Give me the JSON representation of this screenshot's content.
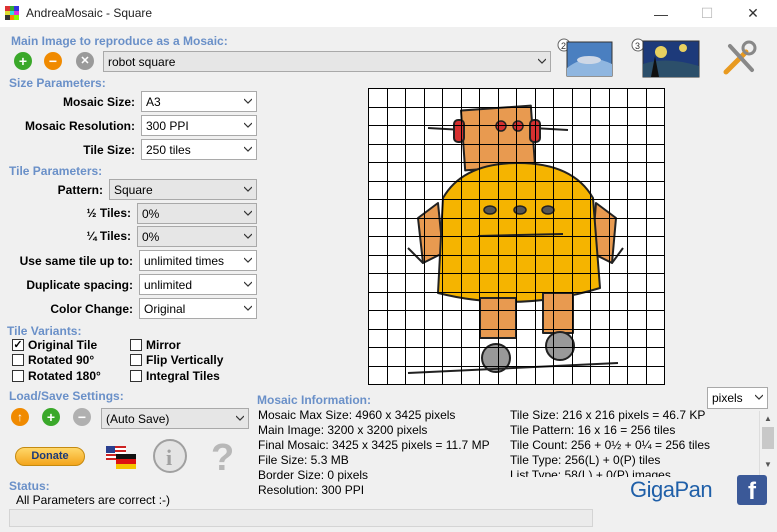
{
  "window": {
    "title": "AndreaMosaic - Square",
    "minimize": "—",
    "maximize": "☐",
    "close": "✕"
  },
  "main_image": {
    "section_label": "Main Image to reproduce as a Mosaic:",
    "selected": "robot square"
  },
  "size_params": {
    "section_label": "Size Parameters:",
    "mosaic_size_label": "Mosaic Size:",
    "mosaic_size_value": "A3",
    "resolution_label": "Mosaic Resolution:",
    "resolution_value": "300 PPI",
    "tile_size_label": "Tile Size:",
    "tile_size_value": "250 tiles"
  },
  "tile_params": {
    "section_label": "Tile Parameters:",
    "pattern_label": "Pattern:",
    "pattern_value": "Square",
    "half_tiles_label": "½ Tiles:",
    "half_tiles_value": "0%",
    "quarter_tiles_label": "¼ Tiles:",
    "quarter_tiles_value": "0%",
    "same_tile_label": "Use same tile up to:",
    "same_tile_value": "unlimited times",
    "dup_spacing_label": "Duplicate spacing:",
    "dup_spacing_value": "unlimited",
    "color_change_label": "Color Change:",
    "color_change_value": "Original"
  },
  "tile_variants": {
    "section_label": "Tile Variants:",
    "original_tile": "Original Tile",
    "rotated_90": "Rotated 90°",
    "rotated_180": "Rotated 180°",
    "mirror": "Mirror",
    "flip_vertically": "Flip Vertically",
    "integral_tiles": "Integral Tiles"
  },
  "load_save": {
    "section_label": "Load/Save Settings:",
    "selected": "(Auto Save)",
    "donate_label": "Donate"
  },
  "status": {
    "section_label": "Status:",
    "message": "All Parameters are correct :-)"
  },
  "mosaic_info": {
    "section_label": "Mosaic Information:",
    "unit_value": "pixels",
    "left_lines": [
      "Mosaic Max Size: 4960 x 3425 pixels",
      "Main Image: 3200 x 3200 pixels",
      "Final Mosaic: 3425 x 3425 pixels = 11.7 MP",
      "File Size: 5.3 MB",
      "Border Size: 0 pixels",
      "Resolution: 300 PPI"
    ],
    "right_lines": [
      "Tile Size: 216 x 216 pixels = 46.7 KP",
      "Tile Pattern: 16 x 16 = 256 tiles",
      "Tile Count: 256 + 0½ + 0¼ = 256 tiles",
      "Tile Type: 256(L) + 0(P) tiles",
      "List Type: 58(L) + 0(P) images"
    ]
  },
  "branding": {
    "gigapan": "GigaPan",
    "facebook": "f"
  },
  "colors": {
    "section": "#6a90c8",
    "robot_yellow": "#f5b400",
    "robot_orange": "#e89a50",
    "green": "#3aa82a",
    "orange": "#f08a00"
  }
}
